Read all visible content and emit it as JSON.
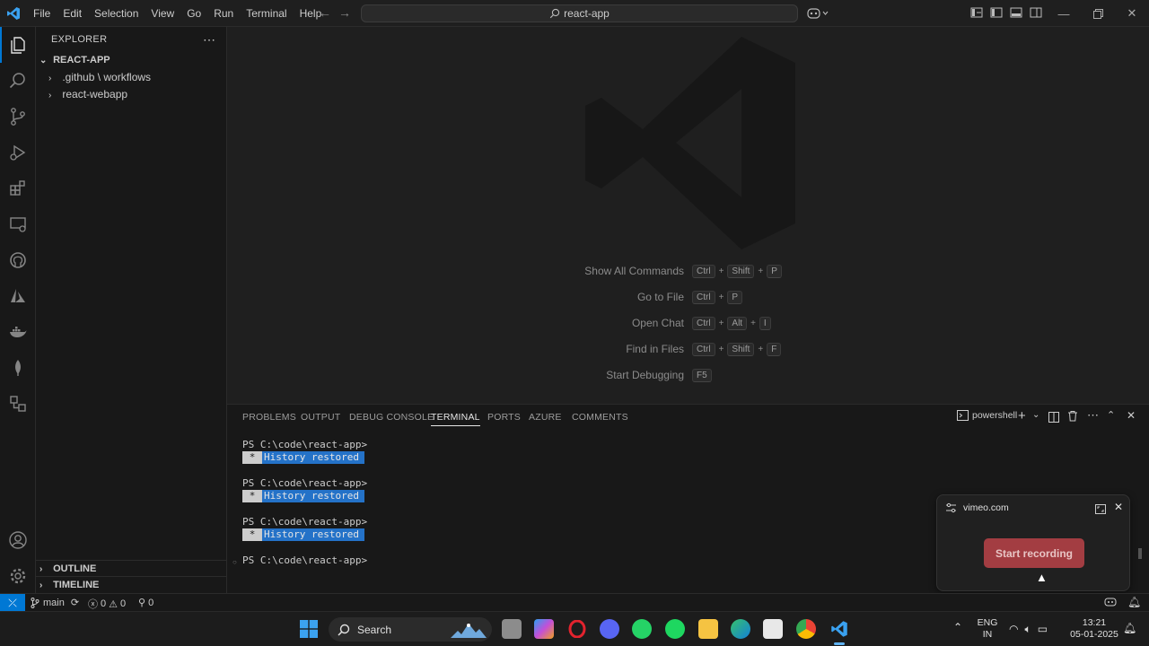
{
  "menu": [
    "File",
    "Edit",
    "Selection",
    "View",
    "Go",
    "Run",
    "Terminal",
    "Help"
  ],
  "command_center": {
    "label": "react-app"
  },
  "sidebar": {
    "title": "EXPLORER",
    "root": "REACT-APP",
    "items": [
      {
        "label": ".github \\ workflows"
      },
      {
        "label": "react-webapp"
      }
    ],
    "outline": "OUTLINE",
    "timeline": "TIMELINE"
  },
  "editor_hints": [
    {
      "label": "Show All Commands",
      "keys": [
        "Ctrl",
        "Shift",
        "P"
      ]
    },
    {
      "label": "Go to File",
      "keys": [
        "Ctrl",
        "P"
      ]
    },
    {
      "label": "Open Chat",
      "keys": [
        "Ctrl",
        "Alt",
        "I"
      ]
    },
    {
      "label": "Find in Files",
      "keys": [
        "Ctrl",
        "Shift",
        "F"
      ]
    },
    {
      "label": "Start Debugging",
      "keys": [
        "F5"
      ]
    }
  ],
  "panel": {
    "tabs": [
      "PROBLEMS",
      "OUTPUT",
      "DEBUG CONSOLE",
      "TERMINAL",
      "PORTS",
      "AZURE",
      "COMMENTS"
    ],
    "active_tab": "TERMINAL",
    "shell": "powershell"
  },
  "terminal": {
    "prompt": "PS C:\\code\\react-app>",
    "history_star": "*",
    "history_text": "History restored"
  },
  "vimeo": {
    "site": "vimeo.com",
    "button": "Start recording"
  },
  "statusbar": {
    "branch": "main",
    "errors": "0",
    "warnings": "0",
    "ports": "0"
  },
  "taskbar": {
    "search": "Search",
    "lang_top": "ENG",
    "lang_bottom": "IN",
    "time": "13:21",
    "date": "05-01-2025"
  },
  "colors": {
    "accent": "#0078d4",
    "record_button": "#a33d42",
    "history_highlight": "#2472c8"
  }
}
